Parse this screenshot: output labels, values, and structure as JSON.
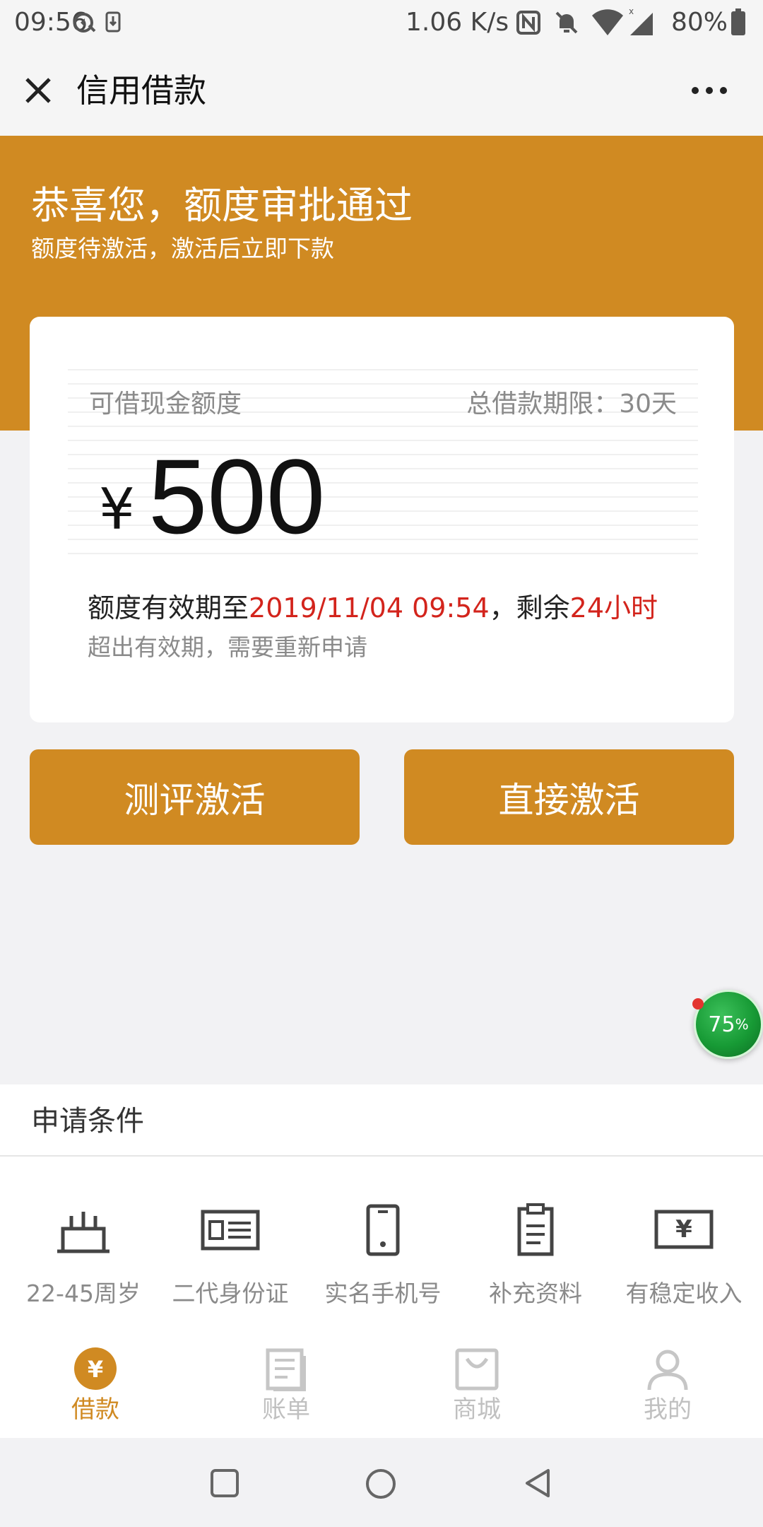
{
  "status_bar": {
    "time": "09:56",
    "net_speed": "1.06 K/s",
    "battery": "80%",
    "icons": [
      "vpn-icon",
      "download-icon",
      "nfc-icon",
      "mute-icon",
      "wifi-icon",
      "signal-icon",
      "battery-icon"
    ]
  },
  "header": {
    "title": "信用借款",
    "close_icon": "close-icon",
    "more_icon": "more-icon"
  },
  "banner": {
    "title": "恭喜您，额度审批通过",
    "subtitle": "额度待激活，激活后立即下款",
    "color": "#d08a22"
  },
  "credit": {
    "label": "可借现金额度",
    "term_label": "总借款期限：30天",
    "currency": "¥",
    "amount": "500",
    "validity_prefix": "额度有效期至",
    "validity_date": "2019/11/04 09:54",
    "validity_mid": "，剩余",
    "validity_remaining": "24小时",
    "note": "超出有效期，需要重新申请",
    "highlight_color": "#d3241c"
  },
  "actions": {
    "evaluate_label": "测评激活",
    "direct_label": "直接激活"
  },
  "floating_badge": {
    "value": "75",
    "unit": "%"
  },
  "conditions": {
    "title": "申请条件",
    "items": [
      {
        "label": "22-45周岁",
        "icon": "cake-icon"
      },
      {
        "label": "二代身份证",
        "icon": "id-card-icon"
      },
      {
        "label": "实名手机号",
        "icon": "phone-icon"
      },
      {
        "label": "补充资料",
        "icon": "clipboard-icon"
      },
      {
        "label": "有稳定收入",
        "icon": "income-card-icon"
      }
    ]
  },
  "tabs": [
    {
      "label": "借款",
      "icon": "yuan-icon",
      "active": true
    },
    {
      "label": "账单",
      "icon": "bill-icon",
      "active": false
    },
    {
      "label": "商城",
      "icon": "shop-bag-icon",
      "active": false
    },
    {
      "label": "我的",
      "icon": "user-icon",
      "active": false
    }
  ],
  "system_nav": [
    "recent-apps-icon",
    "home-icon",
    "back-icon"
  ]
}
